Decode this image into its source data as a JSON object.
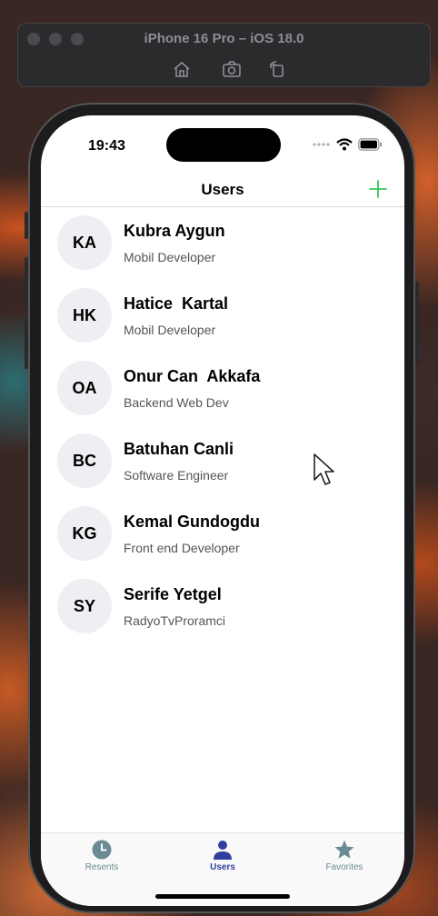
{
  "simulator": {
    "title": "iPhone 16 Pro – iOS 18.0",
    "tools": [
      "home-icon",
      "screenshot-icon",
      "rotate-icon"
    ]
  },
  "status_bar": {
    "time": "19:43"
  },
  "nav": {
    "title": "Users",
    "add_icon": "plus-icon",
    "accent": "#34c759"
  },
  "users": [
    {
      "initials": "KA",
      "name": "Kubra Aygun",
      "role": "Mobil Developer"
    },
    {
      "initials": "HK",
      "name": "Hatice  Kartal",
      "role": "Mobil Developer"
    },
    {
      "initials": "OA",
      "name": "Onur Can  Akkafa",
      "role": "Backend Web Dev"
    },
    {
      "initials": "BC",
      "name": "Batuhan Canli",
      "role": "Software Engineer"
    },
    {
      "initials": "KG",
      "name": "Kemal Gundogdu",
      "role": "Front end Developer"
    },
    {
      "initials": "SY",
      "name": "Serife Yetgel",
      "role": "RadyoTvProramci"
    }
  ],
  "tabs": [
    {
      "label": "Resents",
      "icon": "clock-icon",
      "selected": false
    },
    {
      "label": "Users",
      "icon": "person-icon",
      "selected": true
    },
    {
      "label": "Favorites",
      "icon": "star-icon",
      "selected": false
    }
  ],
  "colors": {
    "tab_selected": "#2f3f9e",
    "tab_unselected": "#6b8a93"
  }
}
